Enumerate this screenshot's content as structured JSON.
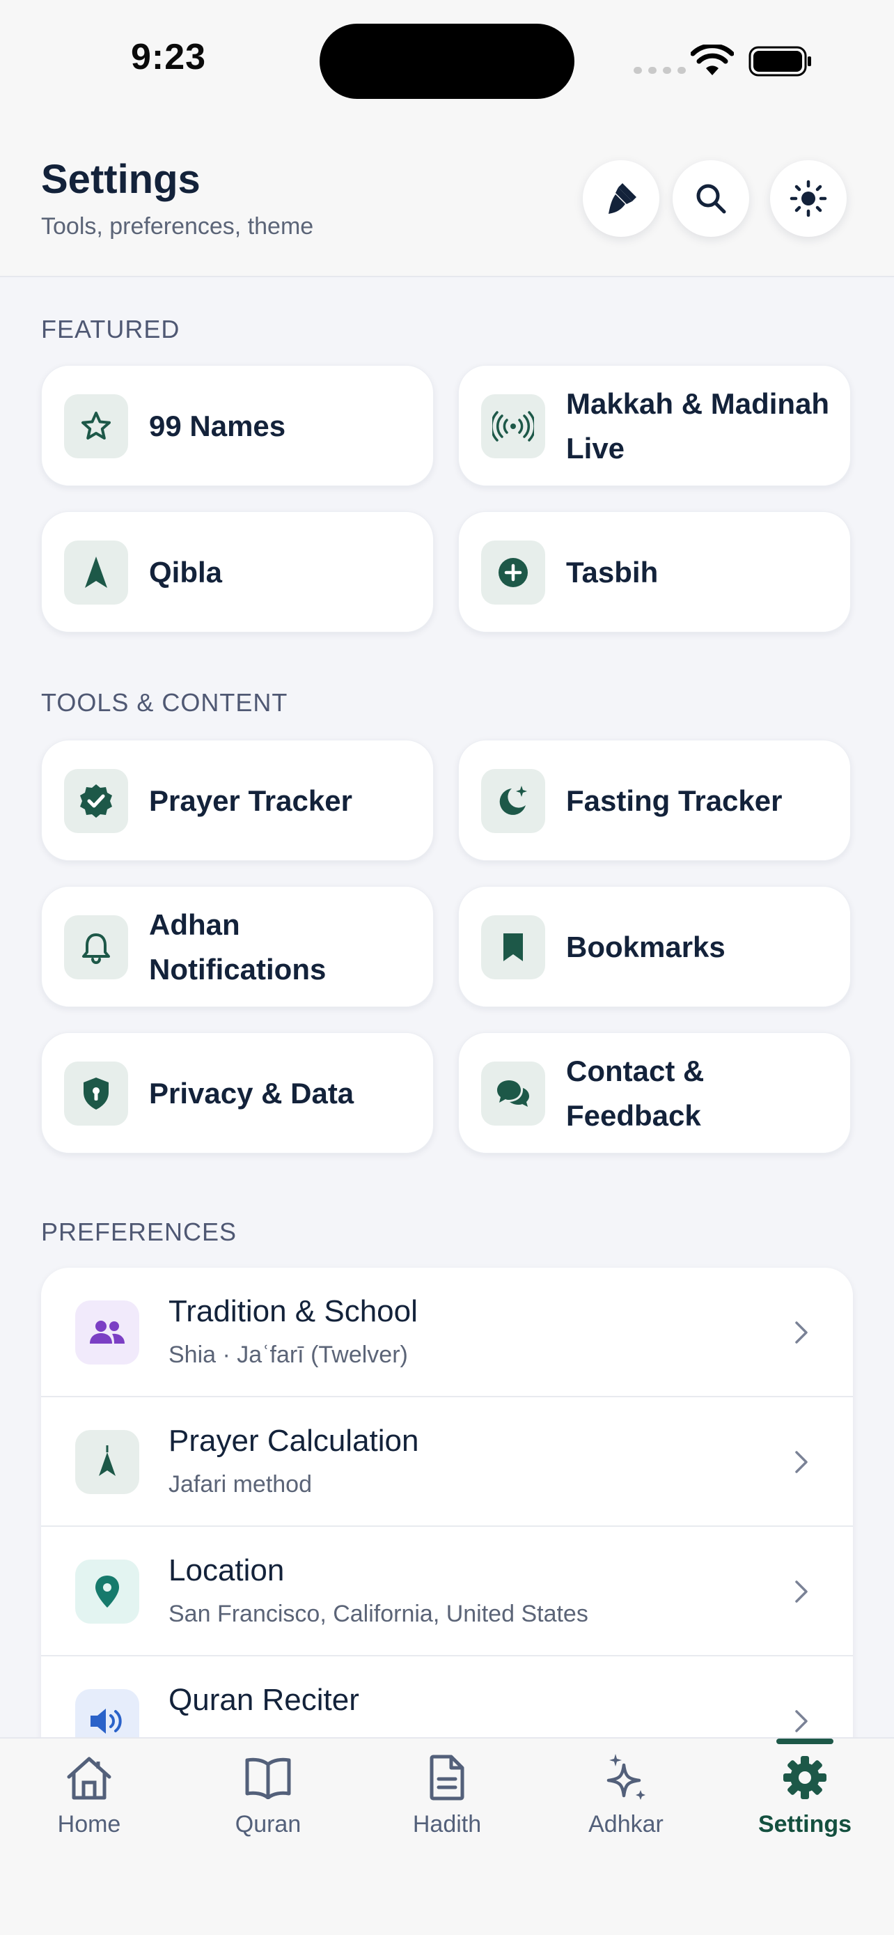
{
  "status_bar": {
    "time": "9:23"
  },
  "header": {
    "title": "Settings",
    "subtitle": "Tools, preferences, theme",
    "buttons": [
      {
        "icon": "paintbrush-icon"
      },
      {
        "icon": "search-icon"
      },
      {
        "icon": "sun-icon"
      }
    ]
  },
  "featured": {
    "title": "FEATURED",
    "items": [
      {
        "label": "99 Names",
        "icon": "star-icon"
      },
      {
        "label": "Makkah & Madinah Live",
        "icon": "broadcast-icon"
      },
      {
        "label": "Qibla",
        "icon": "compass-arrow-icon"
      },
      {
        "label": "Tasbih",
        "icon": "plus-circle-icon"
      }
    ]
  },
  "tools": {
    "title": "TOOLS & CONTENT",
    "items": [
      {
        "label": "Prayer Tracker",
        "icon": "badge-check-icon"
      },
      {
        "label": "Fasting Tracker",
        "icon": "moon-star-icon"
      },
      {
        "label": "Adhan Notifications",
        "icon": "bell-icon"
      },
      {
        "label": "Bookmarks",
        "icon": "bookmark-icon"
      },
      {
        "label": "Privacy & Data",
        "icon": "shield-icon"
      },
      {
        "label": "Contact & Feedback",
        "icon": "chat-icon"
      }
    ]
  },
  "preferences": {
    "title": "PREFERENCES",
    "items": [
      {
        "title": "Tradition & School",
        "subtitle": "Shia · Jaʿfarī (Twelver)",
        "icon": "users-icon",
        "color": "#7b3fc4"
      },
      {
        "title": "Prayer Calculation",
        "subtitle": "Jafari method",
        "icon": "compass-arrow-icon",
        "color": "#1d5848"
      },
      {
        "title": "Location",
        "subtitle": "San Francisco, California, United States",
        "icon": "map-pin-icon",
        "color": "#167a6c"
      },
      {
        "title": "Quran Reciter",
        "subtitle": "",
        "icon": "speaker-icon",
        "color": "#2a62c9"
      }
    ]
  },
  "tabbar": {
    "active": "Settings",
    "tabs": [
      {
        "label": "Home",
        "icon": "home-icon"
      },
      {
        "label": "Quran",
        "icon": "book-icon"
      },
      {
        "label": "Hadith",
        "icon": "document-icon"
      },
      {
        "label": "Adhkar",
        "icon": "sparkles-icon"
      },
      {
        "label": "Settings",
        "icon": "gear-icon"
      }
    ]
  },
  "colors": {
    "accent": "#1d5848",
    "background": "#f4f5f9",
    "card": "#ffffff",
    "icon_tile": "#e7eeeb"
  }
}
